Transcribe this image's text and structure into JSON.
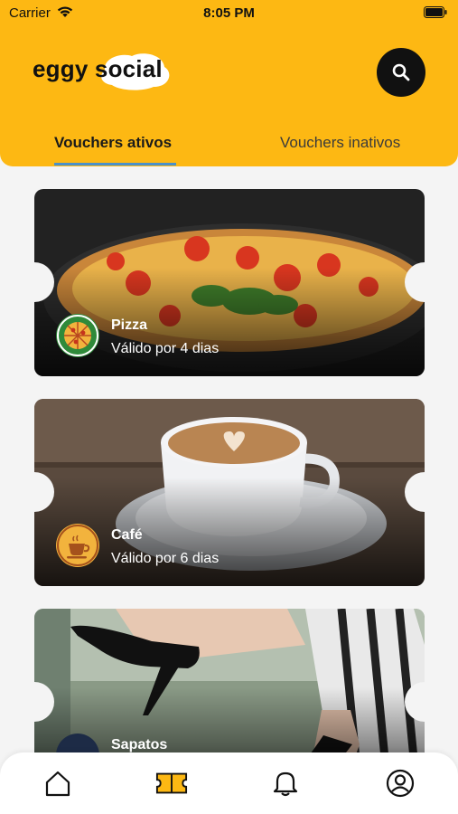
{
  "status_bar": {
    "carrier": "Carrier",
    "time": "8:05 PM"
  },
  "header": {
    "logo_text": "eggy social",
    "search_icon": "search-icon",
    "brand_color": "#FDB813"
  },
  "tabs": [
    {
      "label": "Vouchers ativos",
      "active": true
    },
    {
      "label": "Vouchers inativos",
      "active": false
    }
  ],
  "vouchers": [
    {
      "title": "Pizza",
      "validity": "Válido por 4 dias",
      "icon": "pizza-icon"
    },
    {
      "title": "Café",
      "validity": "Válido por 6 dias",
      "icon": "coffee-cup-icon"
    },
    {
      "title": "Sapatos",
      "validity": "",
      "icon": "shoe-icon"
    }
  ],
  "bottom_nav": [
    {
      "name": "home",
      "icon": "home-icon",
      "active": false
    },
    {
      "name": "vouchers",
      "icon": "ticket-icon",
      "active": true
    },
    {
      "name": "notifications",
      "icon": "bell-icon",
      "active": false
    },
    {
      "name": "profile",
      "icon": "profile-icon",
      "active": false
    }
  ]
}
